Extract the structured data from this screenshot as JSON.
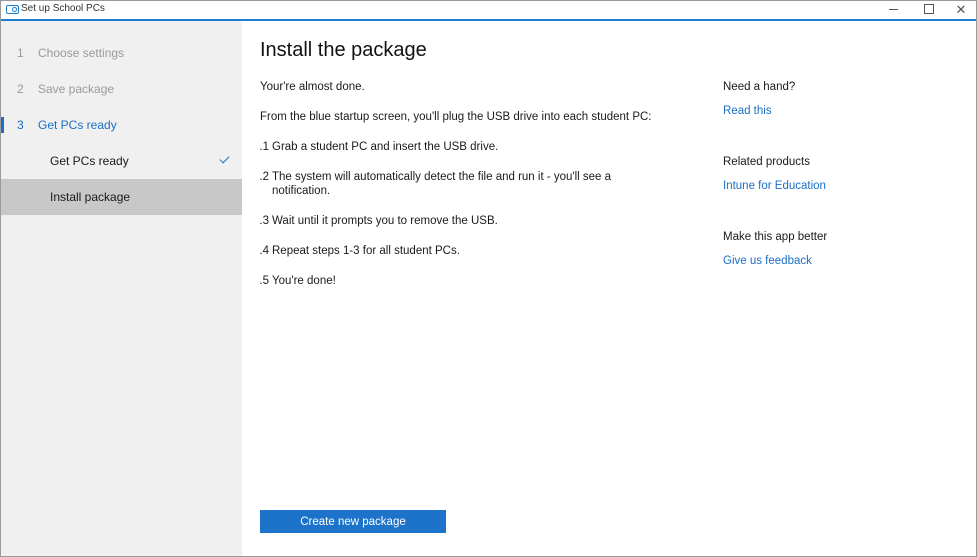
{
  "window": {
    "title": "Set up School PCs",
    "controls": {
      "minimize": "minimize-icon",
      "maximize": "maximize-icon",
      "close": "close-icon"
    }
  },
  "sidebar": {
    "steps": [
      {
        "number": "1",
        "label": "Choose settings",
        "state": "disabled"
      },
      {
        "number": "2",
        "label": "Save package",
        "state": "disabled"
      },
      {
        "number": "3",
        "label": "Get PCs ready",
        "state": "active"
      }
    ],
    "substeps": [
      {
        "label": "Get PCs ready",
        "completed": true,
        "icon": "checkmark-icon"
      },
      {
        "label": "Install package",
        "selected": true
      }
    ]
  },
  "main": {
    "title": "Install the package",
    "intro": "Your're almost done.",
    "instruction": "From the blue startup screen, you'll plug the USB drive into each student PC:",
    "steps": [
      {
        "number": "1.",
        "text": "Grab a student PC and insert the USB drive."
      },
      {
        "number": "2.",
        "text": "The system will automatically detect the file and run it - you'll see a notification."
      },
      {
        "number": "3.",
        "text": "Wait until it prompts you to remove the USB."
      },
      {
        "number": "4.",
        "text": "Repeat steps 1-3 for all student PCs."
      },
      {
        "number": "5.",
        "text": "You're done!"
      }
    ],
    "primary_button": "Create new package"
  },
  "help": {
    "sections": [
      {
        "heading": "Need a hand?",
        "link": "Read this"
      },
      {
        "heading": "Related products",
        "link": "Intune for Education"
      },
      {
        "heading": "Make this app better",
        "link": "Give us feedback"
      }
    ]
  },
  "colors": {
    "accent": "#1c6fc4",
    "button": "#1c73c9",
    "sidebar_bg": "#f0f0f0",
    "selected_bg": "#c8c8c8"
  }
}
